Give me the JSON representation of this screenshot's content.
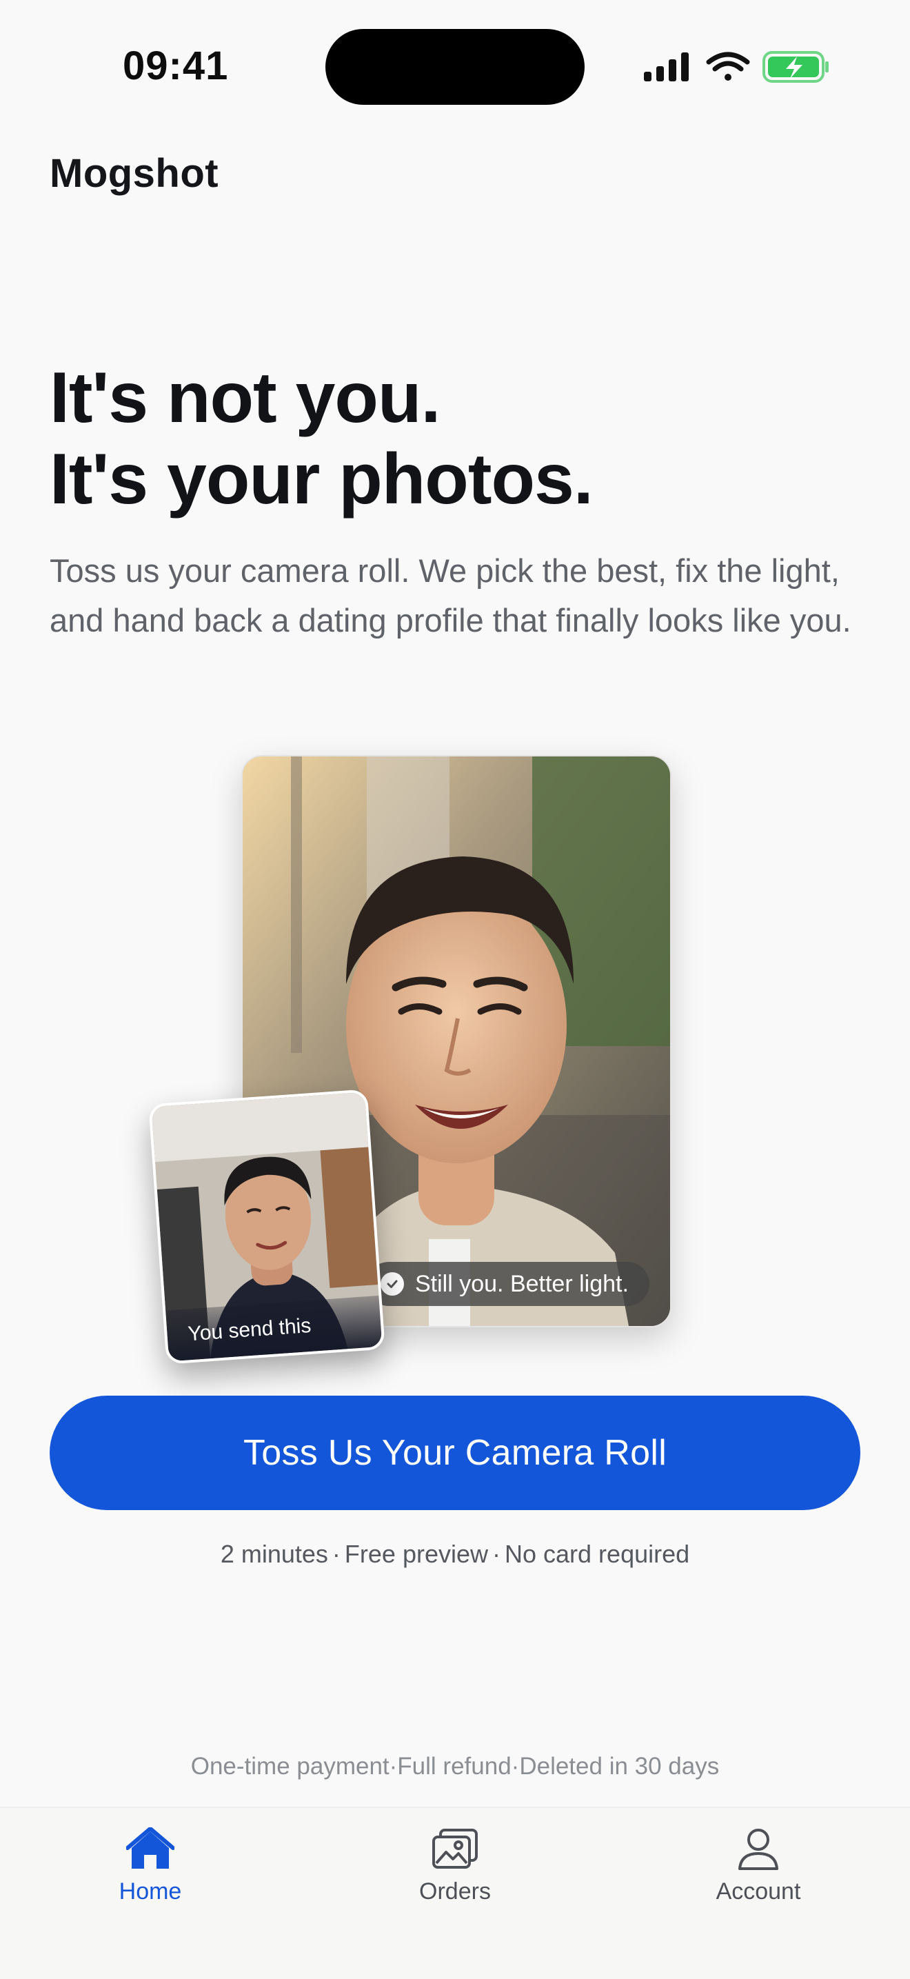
{
  "status_bar": {
    "time": "09:41"
  },
  "app": {
    "brand": "Mogshot"
  },
  "hero": {
    "headline_line1": "It's not you.",
    "headline_line2": "It's your photos.",
    "subtext": "Toss us your camera roll. We pick the best, fix the light, and hand back a dating profile that finally looks like you.",
    "result_badge": "Still you. Better light.",
    "thumb_caption": "You send this"
  },
  "cta": {
    "label": "Toss Us Your Camera Roll",
    "meta": [
      "2 minutes",
      "Free preview",
      "No card required"
    ]
  },
  "footer_note": [
    "One-time payment",
    "Full refund",
    "Deleted in 30 days"
  ],
  "tabs": [
    {
      "label": "Home",
      "icon": "home-icon",
      "active": true
    },
    {
      "label": "Orders",
      "icon": "photos-icon",
      "active": false
    },
    {
      "label": "Account",
      "icon": "person-icon",
      "active": false
    }
  ],
  "colors": {
    "accent": "#1456d9",
    "battery": "#34c759",
    "background": "#f9f9f9"
  }
}
